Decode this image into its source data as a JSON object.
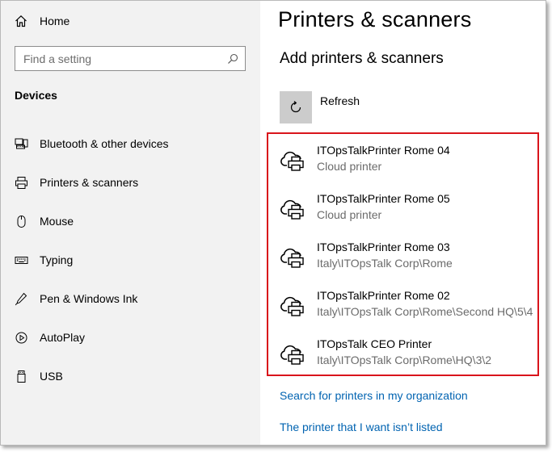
{
  "sidebar": {
    "home_label": "Home",
    "search_placeholder": "Find a setting",
    "section_title": "Devices",
    "items": [
      {
        "label": "Bluetooth & other devices",
        "icon": "bluetooth-devices-icon"
      },
      {
        "label": "Printers & scanners",
        "icon": "printer-icon"
      },
      {
        "label": "Mouse",
        "icon": "mouse-icon"
      },
      {
        "label": "Typing",
        "icon": "keyboard-icon"
      },
      {
        "label": "Pen & Windows Ink",
        "icon": "pen-icon"
      },
      {
        "label": "AutoPlay",
        "icon": "autoplay-icon"
      },
      {
        "label": "USB",
        "icon": "usb-icon"
      }
    ]
  },
  "main": {
    "page_title": "Printers & scanners",
    "sub_title": "Add printers & scanners",
    "refresh_label": "Refresh",
    "printers": [
      {
        "name": "ITOpsTalkPrinter Rome 04",
        "desc": "Cloud printer"
      },
      {
        "name": "ITOpsTalkPrinter Rome 05",
        "desc": "Cloud printer"
      },
      {
        "name": "ITOpsTalkPrinter Rome 03",
        "desc": "Italy\\ITOpsTalk Corp\\Rome"
      },
      {
        "name": "ITOpsTalkPrinter Rome 02",
        "desc": "Italy\\ITOpsTalk Corp\\Rome\\Second HQ\\5\\4"
      },
      {
        "name": "ITOpsTalk CEO Printer",
        "desc": "Italy\\ITOpsTalk Corp\\Rome\\HQ\\3\\2"
      }
    ],
    "link_search_org": "Search for printers in my organization",
    "link_not_listed": "The printer that I want isn’t listed"
  },
  "colors": {
    "sidebar_bg": "#f2f2f2",
    "link": "#0063b1",
    "highlight_border": "#d9141b",
    "refresh_bg": "#cccccc"
  }
}
